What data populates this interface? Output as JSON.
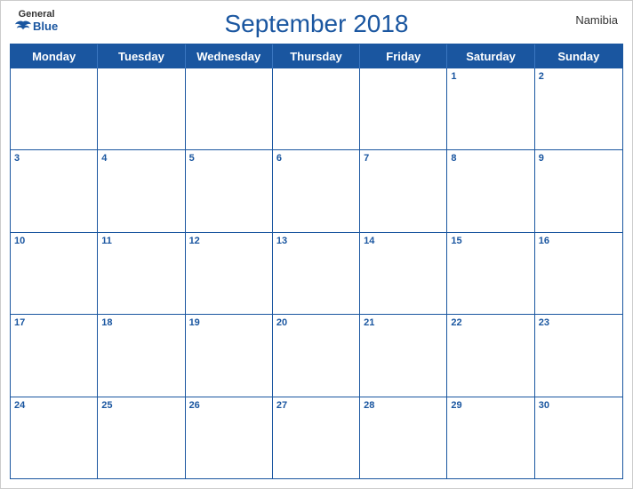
{
  "header": {
    "logo_general": "General",
    "logo_blue": "Blue",
    "title": "September 2018",
    "country": "Namibia"
  },
  "days": {
    "headers": [
      "Monday",
      "Tuesday",
      "Wednesday",
      "Thursday",
      "Friday",
      "Saturday",
      "Sunday"
    ]
  },
  "weeks": [
    [
      {
        "num": "",
        "empty": true
      },
      {
        "num": "",
        "empty": true
      },
      {
        "num": "",
        "empty": true
      },
      {
        "num": "",
        "empty": true
      },
      {
        "num": "",
        "empty": true
      },
      {
        "num": "1",
        "empty": false
      },
      {
        "num": "2",
        "empty": false
      }
    ],
    [
      {
        "num": "3",
        "empty": false
      },
      {
        "num": "4",
        "empty": false
      },
      {
        "num": "5",
        "empty": false
      },
      {
        "num": "6",
        "empty": false
      },
      {
        "num": "7",
        "empty": false
      },
      {
        "num": "8",
        "empty": false
      },
      {
        "num": "9",
        "empty": false
      }
    ],
    [
      {
        "num": "10",
        "empty": false
      },
      {
        "num": "11",
        "empty": false
      },
      {
        "num": "12",
        "empty": false
      },
      {
        "num": "13",
        "empty": false
      },
      {
        "num": "14",
        "empty": false
      },
      {
        "num": "15",
        "empty": false
      },
      {
        "num": "16",
        "empty": false
      }
    ],
    [
      {
        "num": "17",
        "empty": false
      },
      {
        "num": "18",
        "empty": false
      },
      {
        "num": "19",
        "empty": false
      },
      {
        "num": "20",
        "empty": false
      },
      {
        "num": "21",
        "empty": false
      },
      {
        "num": "22",
        "empty": false
      },
      {
        "num": "23",
        "empty": false
      }
    ],
    [
      {
        "num": "24",
        "empty": false
      },
      {
        "num": "25",
        "empty": false
      },
      {
        "num": "26",
        "empty": false
      },
      {
        "num": "27",
        "empty": false
      },
      {
        "num": "28",
        "empty": false
      },
      {
        "num": "29",
        "empty": false
      },
      {
        "num": "30",
        "empty": false
      }
    ]
  ]
}
